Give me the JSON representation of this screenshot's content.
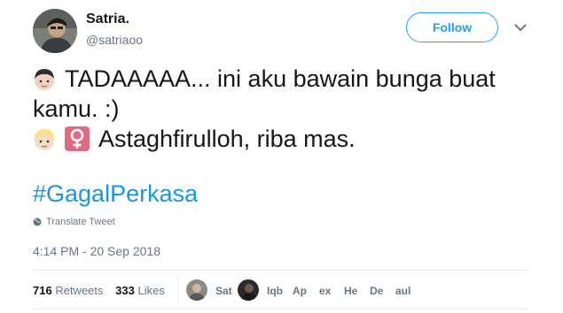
{
  "user": {
    "name": "Satria.",
    "handle": "@satriaoo"
  },
  "follow_label": "Follow",
  "tweet": {
    "line1": "TADAAAAA... ini aku bawain bunga buat",
    "line2": "kamu. :)",
    "line3": "Astaghfirulloh, riba mas.",
    "hashtag": "#GagalPerkasa"
  },
  "translate_label": "Translate Tweet",
  "timestamp": "4:14 PM - 20 Sep 2018",
  "stats": {
    "retweets_count": "716",
    "retweets_label": "Retweets",
    "likes_count": "333",
    "likes_label": "Likes"
  },
  "likers": [
    "Sat",
    "",
    "Iqb",
    "Ap",
    "ex",
    "He",
    "De",
    "aul"
  ],
  "colors": {
    "accent": "#1da1f2",
    "hashtag": "#1b95e0",
    "muted": "#657786",
    "female_sign_bg": "#e06a80"
  },
  "icons": [
    "boy-emoji",
    "blond-person-emoji",
    "female-sign-emoji",
    "globe-icon",
    "chevron-down-icon"
  ]
}
